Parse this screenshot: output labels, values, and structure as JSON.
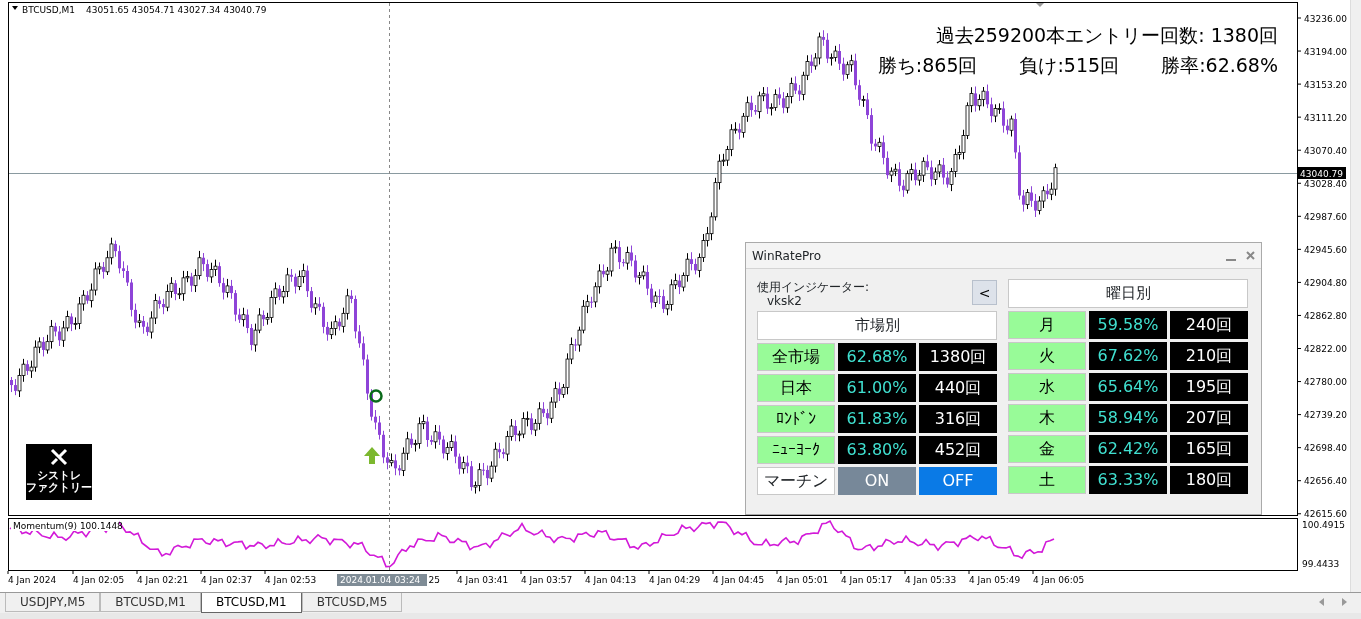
{
  "chart": {
    "symbol": "BTCUSD,M1",
    "ohlc": "43051.65 43054.71 43027.34 43040.79",
    "stats": {
      "entries": "過去259200本エントリー回数: 1380回",
      "wins": "勝ち:865回",
      "losses": "負け:515回",
      "win_rate": "勝率:62.68%"
    },
    "price_axis": [
      "43236.00",
      "43194.00",
      "43153.20",
      "43111.20",
      "43070.40",
      "43028.40",
      "42987.60",
      "42945.60",
      "42904.80",
      "42862.80",
      "42822.00",
      "42780.00",
      "42739.20",
      "42698.40",
      "42656.40",
      "42615.60"
    ],
    "current_price": "43040.79",
    "logo_lines": [
      "シストレ",
      "ファクトリー"
    ]
  },
  "indicator": {
    "label": "Momentum(9) 100.1448",
    "axis": [
      "100.4915",
      "99.4433"
    ]
  },
  "time_axis": {
    "labels": [
      {
        "text": "4 Jan 2024"
      },
      {
        "text": "4 Jan 02:05"
      },
      {
        "text": "4 Jan 02:21"
      },
      {
        "text": "4 Jan 02:37"
      },
      {
        "text": "4 Jan 02:53"
      },
      {
        "text": "25",
        "kind": "cut"
      },
      {
        "text": "4 Jan 03:41"
      },
      {
        "text": "4 Jan 03:57"
      },
      {
        "text": "4 Jan 04:13"
      },
      {
        "text": "4 Jan 04:29"
      },
      {
        "text": "4 Jan 04:45"
      },
      {
        "text": "4 Jan 05:01"
      },
      {
        "text": "4 Jan 05:17"
      },
      {
        "text": "4 Jan 05:33"
      },
      {
        "text": "4 Jan 05:49"
      },
      {
        "text": "4 Jan 06:05"
      }
    ],
    "crosshair_label": "2024.01.04 03:24"
  },
  "panel": {
    "title": "WinRatePro",
    "indicator_label": "使用インジケーター:",
    "indicator_name": "vksk2",
    "back_button": "<",
    "market_header": "市場別",
    "market_rows": [
      {
        "label": "全市場",
        "rate": "62.68%",
        "count": "1380回"
      },
      {
        "label": "日本",
        "rate": "61.00%",
        "count": "440回"
      },
      {
        "label": "ﾛﾝﾄﾞﾝ",
        "rate": "61.83%",
        "count": "316回"
      },
      {
        "label": "ﾆｭｰﾖｰｸ",
        "rate": "63.80%",
        "count": "452回"
      }
    ],
    "martingale": {
      "label": "マーチン",
      "on_label": "ON",
      "off_label": "OFF",
      "enabled": false
    },
    "weekday_header": "曜日別",
    "weekday_rows": [
      {
        "label": "月",
        "rate": "59.58%",
        "count": "240回"
      },
      {
        "label": "火",
        "rate": "67.62%",
        "count": "210回"
      },
      {
        "label": "水",
        "rate": "65.64%",
        "count": "195回"
      },
      {
        "label": "木",
        "rate": "58.94%",
        "count": "207回"
      },
      {
        "label": "金",
        "rate": "62.42%",
        "count": "165回"
      },
      {
        "label": "土",
        "rate": "63.33%",
        "count": "180回"
      }
    ]
  },
  "tabs": [
    {
      "label": "USDJPY,M5",
      "selected": false
    },
    {
      "label": "BTCUSD,M1",
      "selected": false
    },
    {
      "label": "BTCUSD,M1",
      "selected": true
    },
    {
      "label": "BTCUSD,M5",
      "selected": false
    }
  ]
}
